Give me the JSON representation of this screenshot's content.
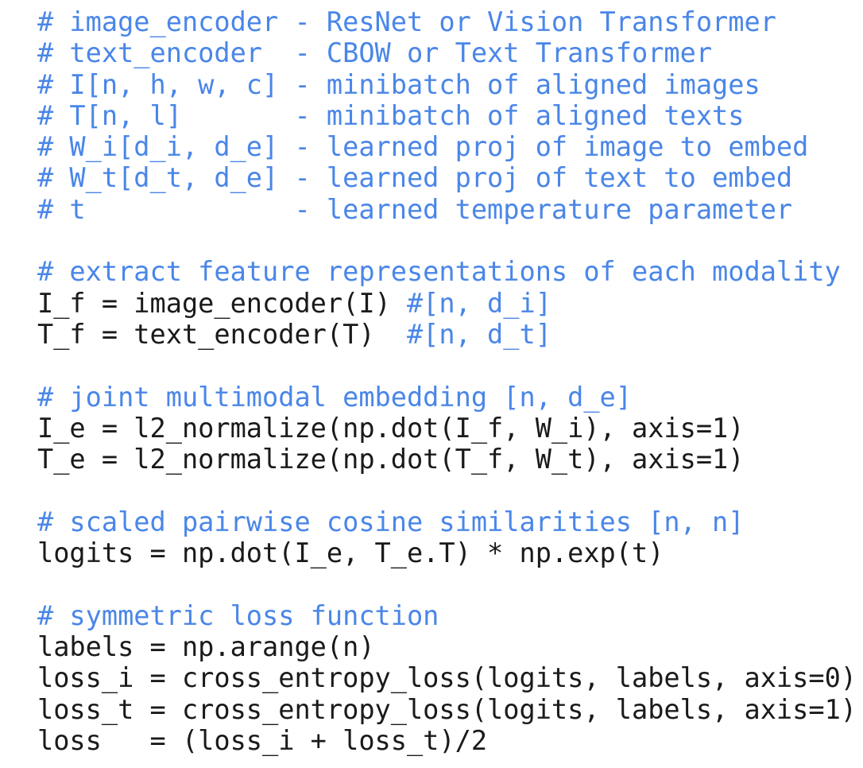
{
  "page": {
    "kind": "code-listing",
    "language": "python-pseudocode",
    "background_color": "#ffffff",
    "code_color": "#1a1a1a",
    "comment_color": "#4a86e8"
  },
  "lines": [
    {
      "type": "comment",
      "text": "# image_encoder - ResNet or Vision Transformer"
    },
    {
      "type": "comment",
      "text": "# text_encoder  - CBOW or Text Transformer"
    },
    {
      "type": "comment",
      "text": "# I[n, h, w, c] - minibatch of aligned images"
    },
    {
      "type": "comment",
      "text": "# T[n, l]       - minibatch of aligned texts"
    },
    {
      "type": "comment",
      "text": "# W_i[d_i, d_e] - learned proj of image to embed"
    },
    {
      "type": "comment",
      "text": "# W_t[d_t, d_e] - learned proj of text to embed"
    },
    {
      "type": "comment",
      "text": "# t             - learned temperature parameter"
    },
    {
      "type": "blank",
      "text": " "
    },
    {
      "type": "comment",
      "text": "# extract feature representations of each modality"
    },
    {
      "type": "mixed",
      "code": "I_f = image_encoder(I) ",
      "comment": "#[n, d_i]"
    },
    {
      "type": "mixed",
      "code": "T_f = text_encoder(T)  ",
      "comment": "#[n, d_t]"
    },
    {
      "type": "blank",
      "text": " "
    },
    {
      "type": "comment",
      "text": "# joint multimodal embedding [n, d_e]"
    },
    {
      "type": "code",
      "text": "I_e = l2_normalize(np.dot(I_f, W_i), axis=1)"
    },
    {
      "type": "code",
      "text": "T_e = l2_normalize(np.dot(T_f, W_t), axis=1)"
    },
    {
      "type": "blank",
      "text": " "
    },
    {
      "type": "comment",
      "text": "# scaled pairwise cosine similarities [n, n]"
    },
    {
      "type": "code",
      "text": "logits = np.dot(I_e, T_e.T) * np.exp(t)"
    },
    {
      "type": "blank",
      "text": " "
    },
    {
      "type": "comment",
      "text": "# symmetric loss function"
    },
    {
      "type": "code",
      "text": "labels = np.arange(n)"
    },
    {
      "type": "code",
      "text": "loss_i = cross_entropy_loss(logits, labels, axis=0)"
    },
    {
      "type": "code",
      "text": "loss_t = cross_entropy_loss(logits, labels, axis=1)"
    },
    {
      "type": "code",
      "text": "loss   = (loss_i + loss_t)/2"
    }
  ]
}
